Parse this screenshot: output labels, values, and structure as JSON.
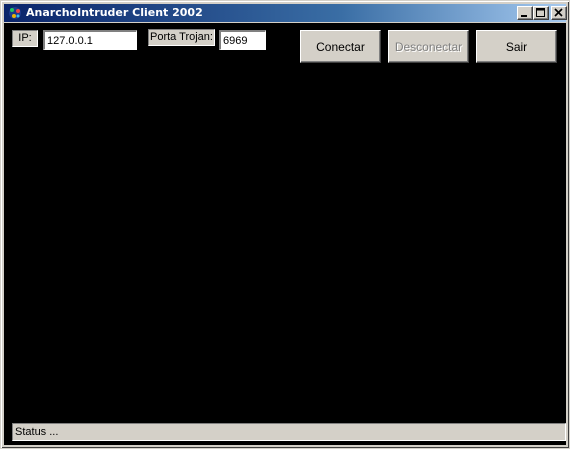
{
  "window": {
    "title": "AnarchoIntruder Client 2002",
    "icon": "app-icon",
    "controls": [
      "minimize-icon",
      "maximize-icon",
      "close-icon"
    ]
  },
  "connection": {
    "ip_label": "IP:",
    "ip_value": "127.0.0.1",
    "port_label": "Porta Trojan:",
    "port_value": "6969"
  },
  "buttons": {
    "connect": "Conectar",
    "disconnect": "Desconectar",
    "disconnect_enabled": false,
    "exit": "Sair"
  },
  "status": {
    "text": "Status ..."
  },
  "colors": {
    "title_gradient_start": "#0a246a",
    "title_gradient_end": "#a6caf0",
    "client_background": "#000000",
    "face": "#d4d0c8"
  }
}
